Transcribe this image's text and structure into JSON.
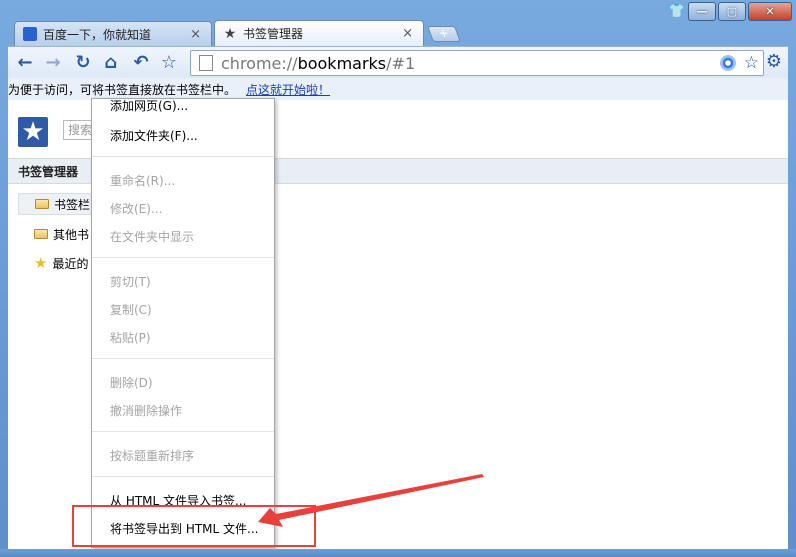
{
  "window": {
    "controls": {
      "shirt": "👕",
      "minimize": "—",
      "maximize": "▢",
      "close": "✕"
    }
  },
  "tabs": [
    {
      "title": "百度一下，你就知道",
      "close": "×",
      "icon": "baidu-paw-icon"
    },
    {
      "title": "书签管理器",
      "close": "×",
      "icon": "star-icon"
    }
  ],
  "new_tab": "+",
  "toolbar": {
    "back": "←",
    "forward": "→",
    "reload": "↻",
    "home": "⌂",
    "undo": "↶",
    "star": "☆",
    "url_scheme": "chrome://",
    "url_host": "bookmarks",
    "url_path": "/#1",
    "bookmark_star": "☆",
    "settings": "⚙"
  },
  "bookmark_bar": {
    "hint": "为便于访问，可将书签直接放在书签栏中。",
    "link": "点这就开始啦！"
  },
  "manager": {
    "search_placeholder": "搜索",
    "section_title": "书签管理器",
    "tree": [
      {
        "label": "书签栏",
        "icon": "folder-icon"
      },
      {
        "label": "其他书",
        "icon": "folder-icon"
      },
      {
        "label": "最近的",
        "icon": "star-icon"
      }
    ]
  },
  "context_menu": {
    "items": [
      {
        "label": "添加网页(G)...",
        "enabled": true
      },
      {
        "label": "添加文件夹(F)...",
        "enabled": true
      },
      {
        "label": "重命名(R)...",
        "enabled": false
      },
      {
        "label": "修改(E)...",
        "enabled": false
      },
      {
        "label": "在文件夹中显示",
        "enabled": false
      },
      {
        "label": "剪切(T)",
        "enabled": false
      },
      {
        "label": "复制(C)",
        "enabled": false
      },
      {
        "label": "粘贴(P)",
        "enabled": false
      },
      {
        "label": "删除(D)",
        "enabled": false
      },
      {
        "label": "撤消删除操作",
        "enabled": false
      },
      {
        "label": "按标题重新排序",
        "enabled": false
      },
      {
        "label": "从 HTML 文件导入书签...",
        "enabled": true
      },
      {
        "label": "将书签导出到 HTML 文件...",
        "enabled": true
      }
    ]
  },
  "colors": {
    "accent": "#2c5aa0",
    "annotation": "#e8403a",
    "disabled_text": "#a4a4a4"
  }
}
